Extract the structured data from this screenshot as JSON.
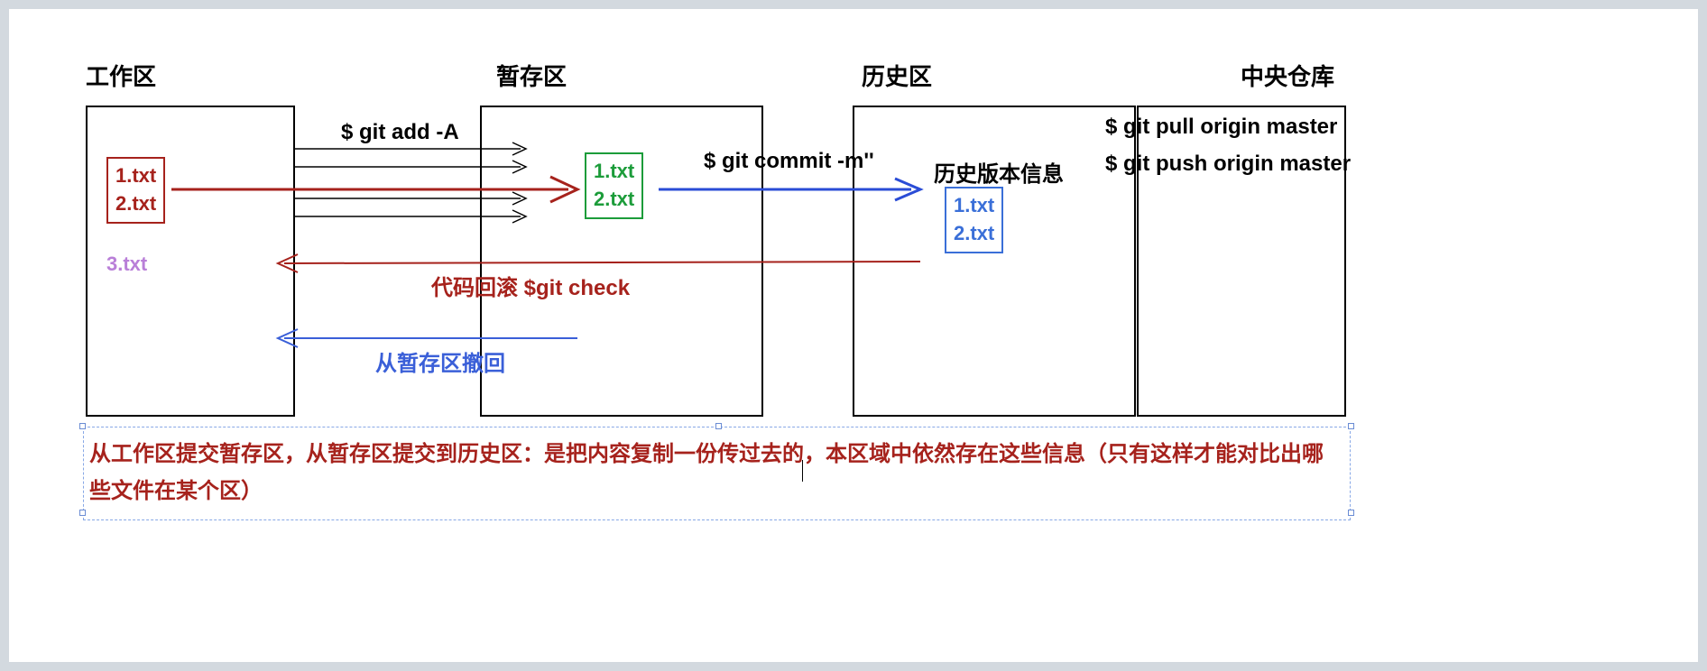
{
  "titles": {
    "work": "工作区",
    "stage": "暂存区",
    "history": "历史区",
    "central": "中央仓库"
  },
  "work_files": {
    "a": "1.txt",
    "b": "2.txt",
    "c": "3.txt"
  },
  "stage_files": {
    "a": "1.txt",
    "b": "2.txt"
  },
  "history_label": "历史版本信息",
  "history_files": {
    "a": "1.txt",
    "b": "2.txt"
  },
  "cmds": {
    "add": "$ git add -A",
    "commit": "$ git commit -m''",
    "pull": "$ git pull origin master",
    "push": "$ git push origin master",
    "checkout": "代码回滚  $git check",
    "unstage": "从暂存区撤回"
  },
  "footnote": "从工作区提交暂存区，从暂存区提交到历史区：是把内容复制一份传过去的，本区域中依然存在这些信息（只有这样才能对比出哪些文件在某个区）"
}
